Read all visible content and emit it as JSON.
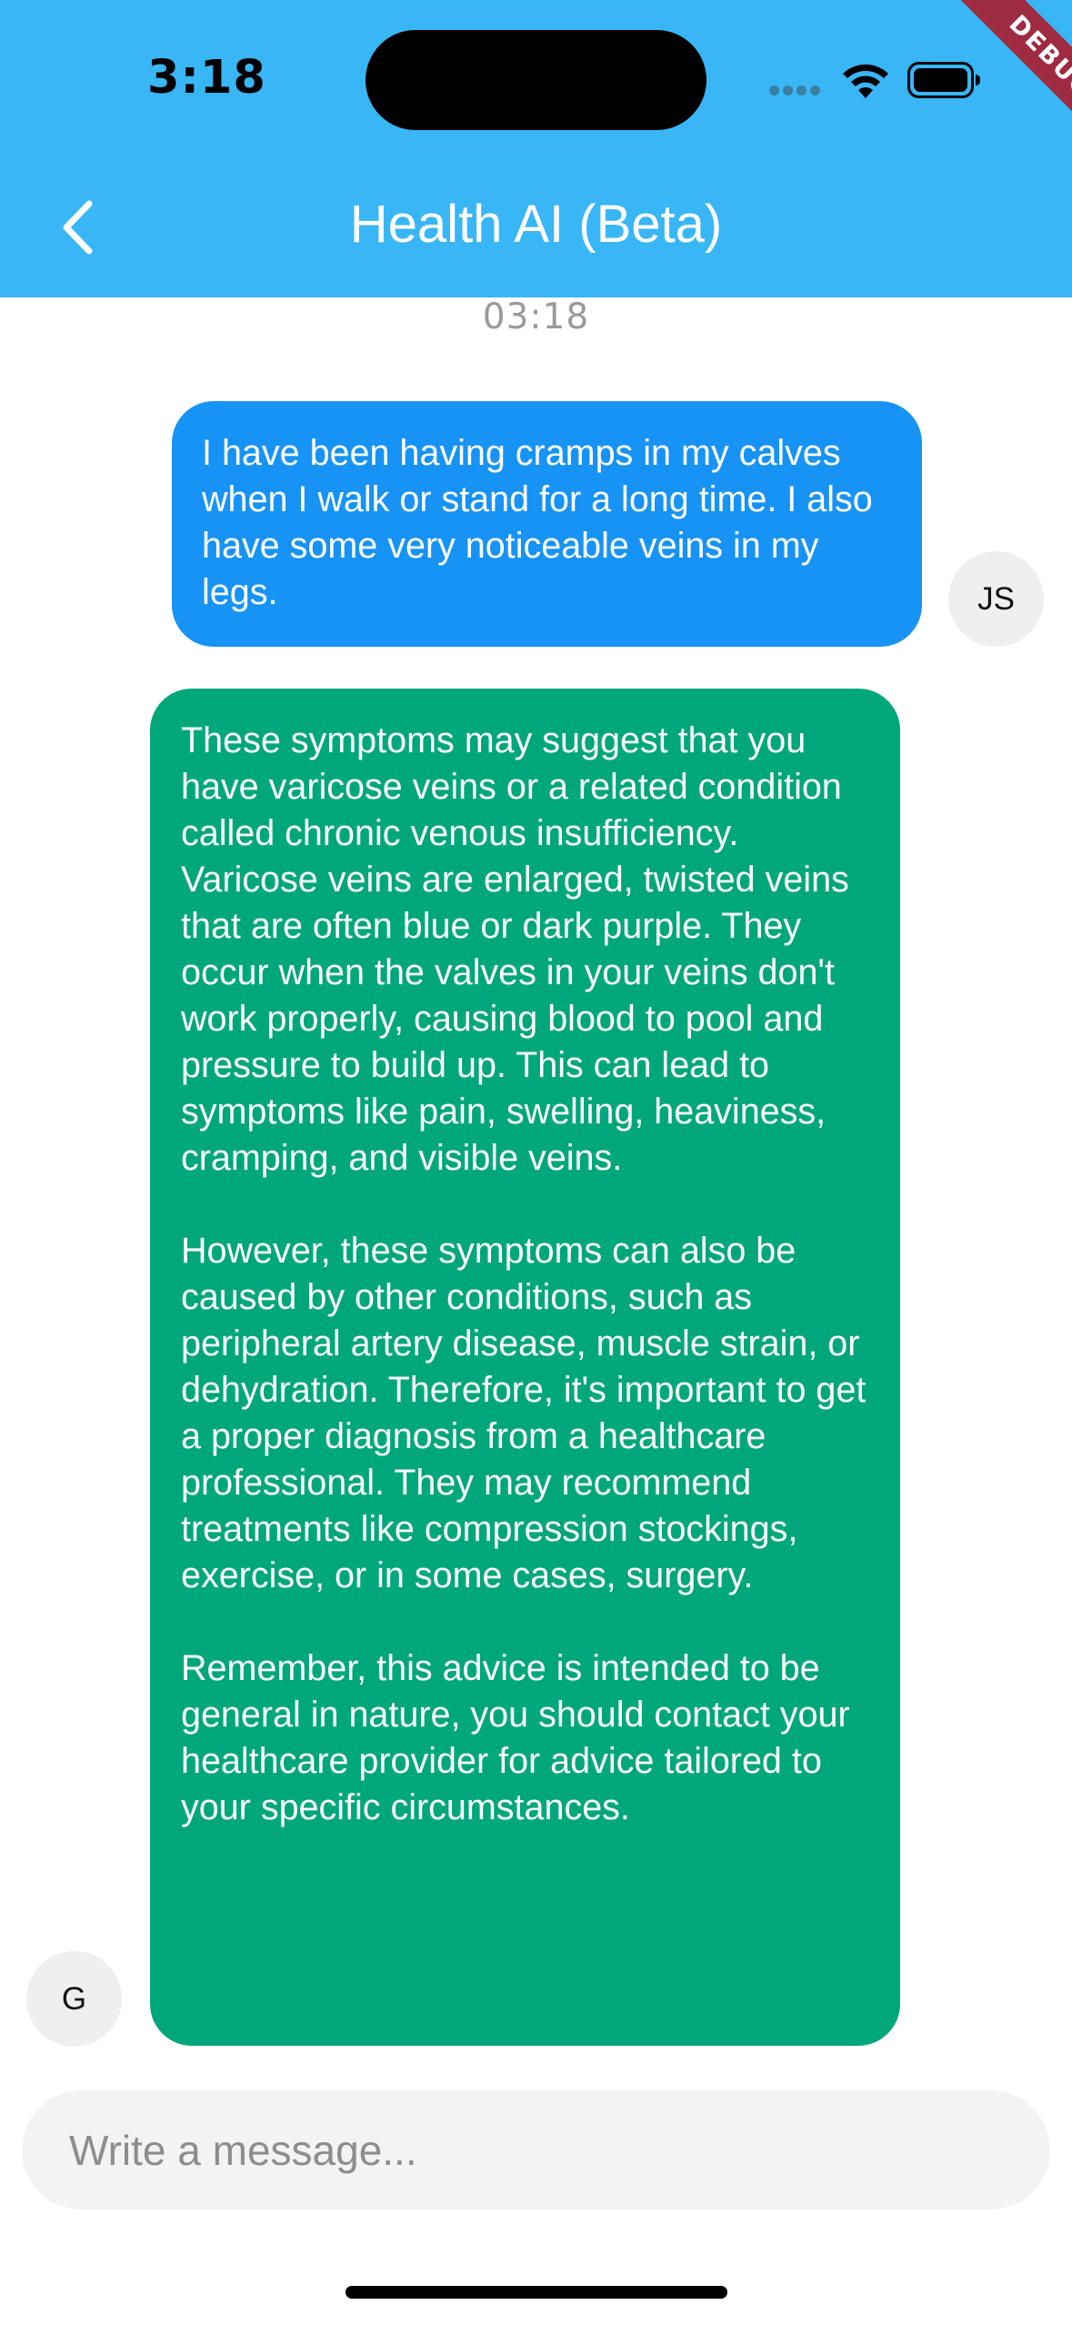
{
  "status_bar": {
    "time": "3:18"
  },
  "debug_banner": "DEBUG",
  "header": {
    "title": "Health AI (Beta)",
    "background": "#38b6f6"
  },
  "chat": {
    "timestamp": "03:18",
    "messages": [
      {
        "sender": "user",
        "avatar_initials": "JS",
        "bubble_color": "#1693f5",
        "text": "I have been having cramps in my calves when I walk or stand for a long time. I also have some very noticeable veins in my legs."
      },
      {
        "sender": "ai",
        "avatar_initials": "G",
        "bubble_color": "#00a77a",
        "text": "These symptoms may suggest that you have varicose veins or a related condition called chronic venous insufficiency. Varicose veins are enlarged, twisted veins that are often blue or dark purple. They occur when the valves in your veins don't work properly, causing blood to pool and pressure to build up. This can lead to symptoms like pain, swelling, heaviness, cramping, and visible veins.\n\nHowever, these symptoms can also be caused by other conditions, such as peripheral artery disease, muscle strain, or dehydration. Therefore, it's important to get a proper diagnosis from a healthcare professional. They may recommend treatments like compression stockings, exercise, or in some cases, surgery.\n\nRemember, this advice is intended to be general in nature, you should contact your healthcare provider for advice tailored to your specific circumstances."
      }
    ]
  },
  "composer": {
    "placeholder": "Write a message...",
    "value": ""
  }
}
